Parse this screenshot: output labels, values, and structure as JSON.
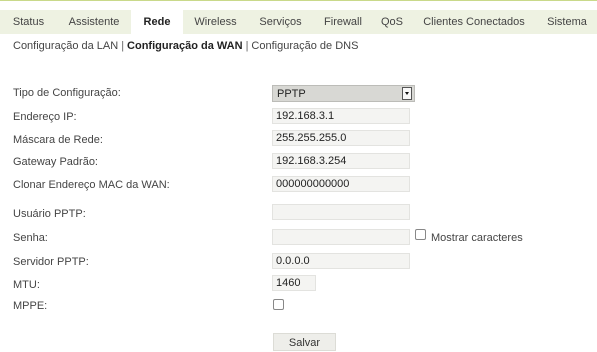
{
  "tabs": [
    {
      "label": "Status"
    },
    {
      "label": "Assistente"
    },
    {
      "label": "Rede",
      "active": true
    },
    {
      "label": "Wireless"
    },
    {
      "label": "Serviços"
    },
    {
      "label": "Firewall"
    },
    {
      "label": "QoS"
    },
    {
      "label": "Clientes Conectados"
    },
    {
      "label": "Sistema"
    }
  ],
  "subnav": {
    "lan": "Configuração da LAN",
    "wan": "Configuração da WAN",
    "dns": "Configuração de DNS",
    "separator": "|"
  },
  "form": {
    "tipo_label": "Tipo de Configuração:",
    "tipo_value": "PPTP",
    "ip_label": "Endereço IP:",
    "ip_value": "192.168.3.1",
    "mask_label": "Máscara de Rede:",
    "mask_value": "255.255.255.0",
    "gateway_label": "Gateway Padrão:",
    "gateway_value": "192.168.3.254",
    "mac_label": "Clonar Endereço MAC da WAN:",
    "mac_value": "000000000000",
    "user_label": "Usuário PPTP:",
    "user_value": "",
    "pass_label": "Senha:",
    "pass_value": "",
    "show_chars_label": "Mostrar caracteres",
    "server_label": "Servidor PPTP:",
    "server_value": "0.0.0.0",
    "mtu_label": "MTU:",
    "mtu_value": "1460",
    "mppe_label": "MPPE:",
    "save_label": "Salvar"
  },
  "colors": {
    "tabbar_bg": "#eef2e2",
    "accent_line": "#c9d98a"
  }
}
